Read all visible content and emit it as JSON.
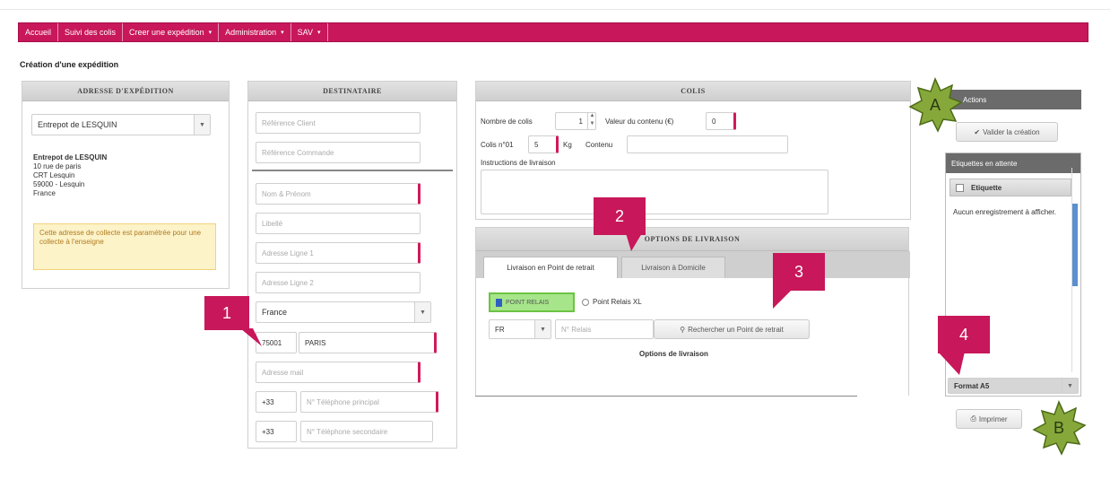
{
  "nav": {
    "items": [
      {
        "label": "Accueil",
        "has_caret": false
      },
      {
        "label": "Suivi des colis",
        "has_caret": false
      },
      {
        "label": "Creer une expédition",
        "has_caret": true
      },
      {
        "label": "Administration",
        "has_caret": true
      },
      {
        "label": "SAV",
        "has_caret": true
      }
    ],
    "caret_glyph": "▾",
    "color": "#c8175a"
  },
  "page_title": "Création d'une expédition",
  "adresse_expedition": {
    "header": "ADRESSE D'EXPÉDITION",
    "select_value": "Entrepot de LESQUIN",
    "address_lines": [
      "Entrepot de LESQUIN",
      "10 rue de paris",
      "CRT Lesquin",
      "59000 - Lesquin",
      "France"
    ],
    "notice": "Cette adresse de collecte est paramétrée pour une collecte à l'enseigne"
  },
  "destinataire": {
    "header": "DESTINATAIRE",
    "reference_client": "Référence Client",
    "reference_commande": "Référence Commande",
    "nom_prenom": "Nom & Prénom",
    "libelle": "Libellé",
    "adresse1": "Adresse Ligne 1",
    "adresse2": "Adresse Ligne 2",
    "pays": "France",
    "code_postal": "75001",
    "ville": "PARIS",
    "email": "Adresse mail",
    "tel_prefix1": "+33",
    "tel_principal": "N° Téléphone principal",
    "tel_prefix2": "+33",
    "tel_secondaire": "N° Téléphone secondaire"
  },
  "colis": {
    "header": "COLIS",
    "nombre_label": "Nombre de colis",
    "nombre_value": "1",
    "valeur_label": "Valeur du contenu (€)",
    "valeur_value": "0",
    "colis_label": "Colis n°01",
    "poids_value": "5",
    "poids_unit": "Kg",
    "contenu_label": "Contenu",
    "instructions_label": "Instructions de livraison"
  },
  "options_livraison": {
    "header": "OPTIONS DE LIVRAISON",
    "tab_point_retrait": "Livraison en Point de retrait",
    "tab_domicile": "Livraison à Domicile",
    "point_relais_chip": "POINT RELAIS",
    "point_relais_xl": "Point Relais XL",
    "country": "FR",
    "relais_placeholder": "N° Relais",
    "search_button": "Rechercher un Point de retrait",
    "options_title": "Options de livraison"
  },
  "right": {
    "header": "Actions",
    "valider_button": "Valider la création",
    "etiquettes_header": "Etiquettes en attente",
    "etiquette_col": "Etiquette",
    "empty_message": "Aucun enregistrement à afficher.",
    "format_value": "Format A5",
    "imprimer_button": "Imprimer"
  },
  "callouts": {
    "one": "1",
    "two": "2",
    "three": "3",
    "four": "4",
    "a": "A",
    "b": "B",
    "callout_color": "#c8175a",
    "star_color": "#86a83a"
  }
}
